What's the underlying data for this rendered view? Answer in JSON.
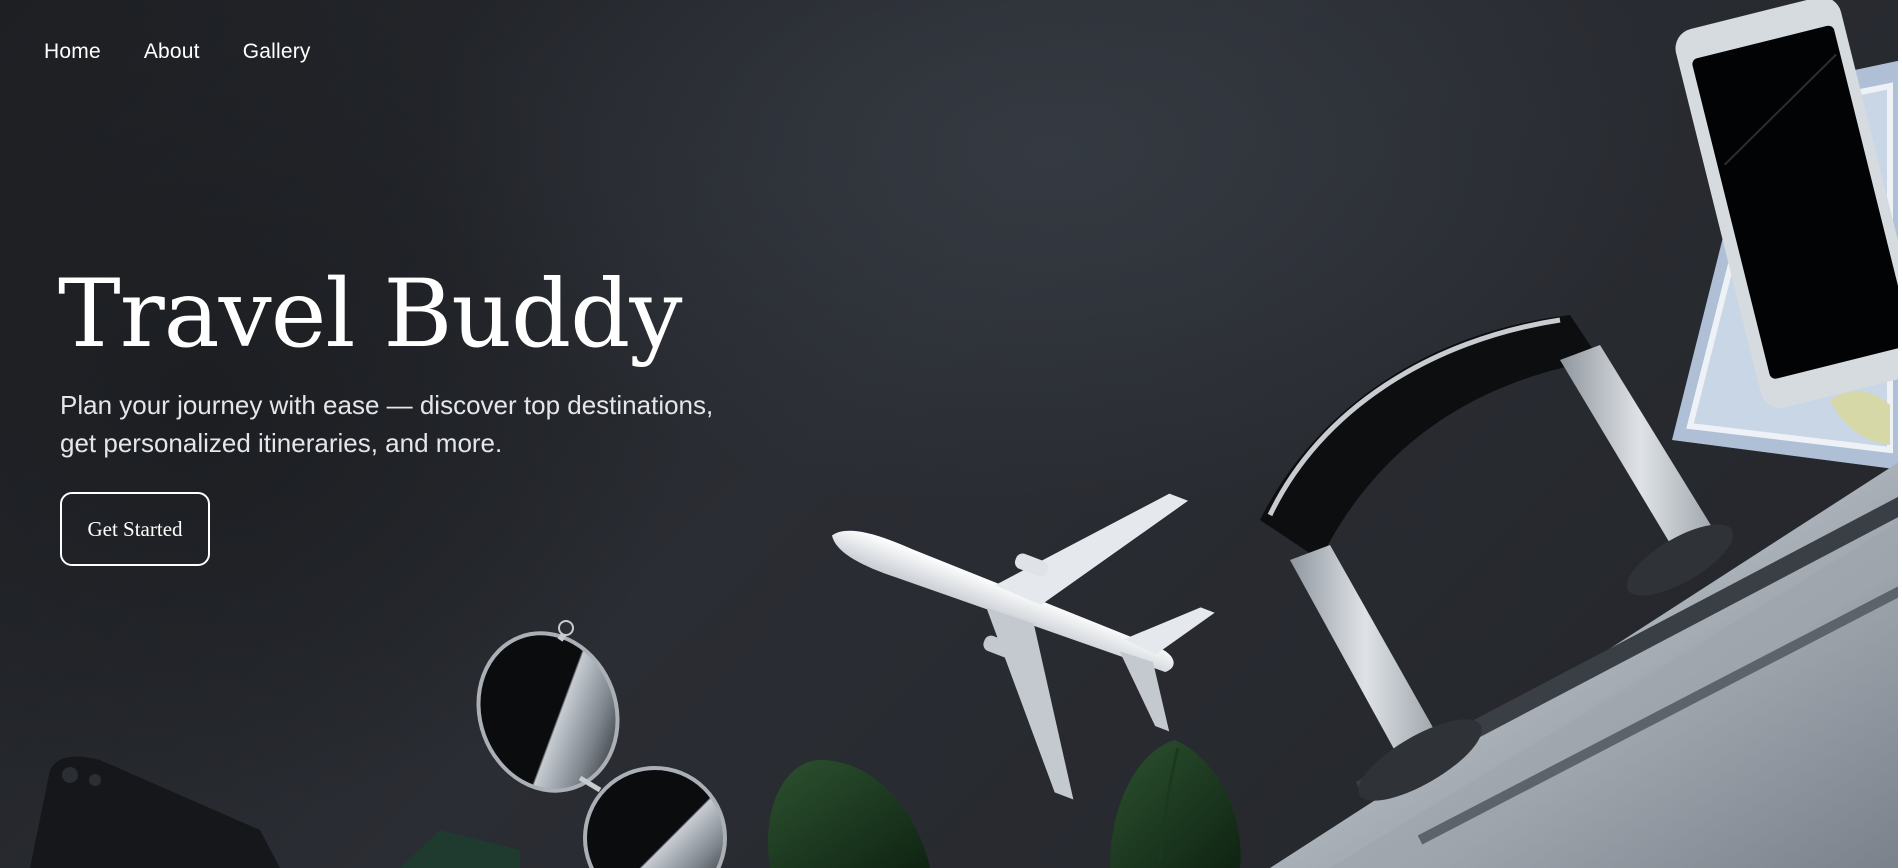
{
  "nav": {
    "items": [
      {
        "label": "Home"
      },
      {
        "label": "About"
      },
      {
        "label": "Gallery"
      }
    ]
  },
  "hero": {
    "title": "Travel Buddy",
    "subtitle_line1": "Plan your journey with ease — discover top destinations,",
    "subtitle_line2": "get personalized itineraries, and more.",
    "cta_label": "Get Started"
  },
  "colors": {
    "background": "#25272c",
    "text": "#ffffff",
    "subtitle": "#e4e6ea",
    "plane": "#e9ecef",
    "luggage": "#8c939c",
    "leaf": "#1f3a22"
  },
  "decor": {
    "icons": [
      "airplane-icon",
      "sunglasses-icon",
      "suitcase-icon",
      "smartphone-icon",
      "map-icon",
      "camera-icon",
      "leaf-icon",
      "passport-icon"
    ]
  }
}
